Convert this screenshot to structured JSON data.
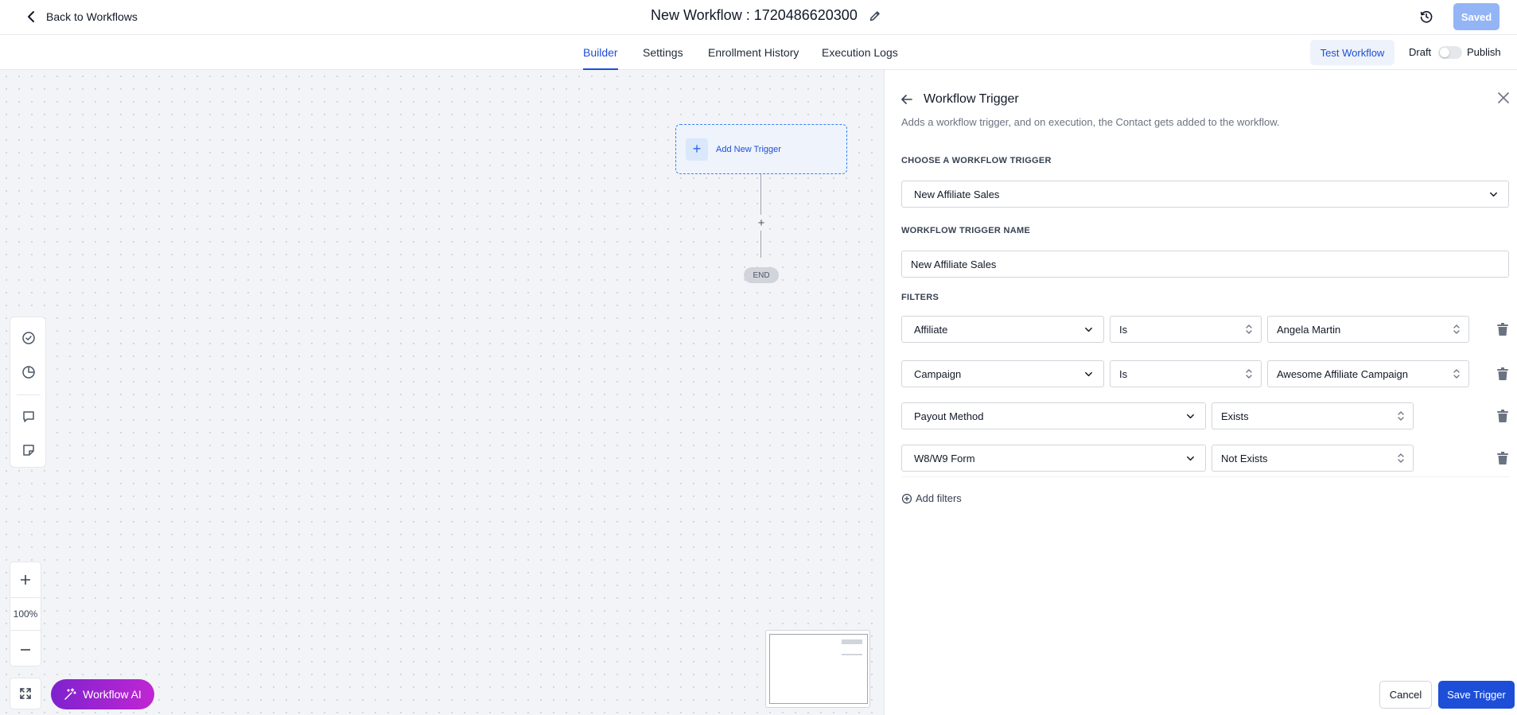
{
  "header": {
    "back_label": "Back to Workflows",
    "title": "New Workflow : 1720486620300",
    "saved_label": "Saved"
  },
  "tabs": [
    {
      "label": "Builder",
      "active": true
    },
    {
      "label": "Settings",
      "active": false
    },
    {
      "label": "Enrollment History",
      "active": false
    },
    {
      "label": "Execution Logs",
      "active": false
    }
  ],
  "actions": {
    "test_label": "Test Workflow",
    "draft_label": "Draft",
    "publish_label": "Publish",
    "published": false
  },
  "canvas": {
    "trigger_label": "Add New Trigger",
    "add_step_symbol": "+",
    "end_label": "END",
    "zoom_level": "100%",
    "ai_label": "Workflow AI",
    "toolbar_icons": [
      "check-circle-icon",
      "pie-chart-icon",
      "comment-icon",
      "sticky-note-icon"
    ]
  },
  "panel": {
    "title": "Workflow Trigger",
    "subtitle": "Adds a workflow trigger, and on execution, the Contact gets added to the workflow.",
    "choose_label": "CHOOSE A WORKFLOW TRIGGER",
    "trigger_value": "New Affiliate Sales",
    "name_label": "WORKFLOW TRIGGER NAME",
    "name_value": "New Affiliate Sales",
    "filters_label": "FILTERS",
    "filters": [
      {
        "field": "Affiliate",
        "operator": "Is",
        "value": "Angela Martin"
      },
      {
        "field": "Campaign",
        "operator": "Is",
        "value": "Awesome Affiliate Campaign"
      },
      {
        "field": "Payout Method",
        "operator": "Exists"
      },
      {
        "field": "W8/W9 Form",
        "operator": "Not Exists"
      }
    ],
    "add_filters_label": "Add filters",
    "cancel_label": "Cancel",
    "save_label": "Save Trigger"
  },
  "colors": {
    "accent": "#1d4ed8",
    "saved_disabled": "#93b4f5",
    "ai_gradient_start": "#7e22ce",
    "ai_gradient_end": "#c026d3"
  }
}
